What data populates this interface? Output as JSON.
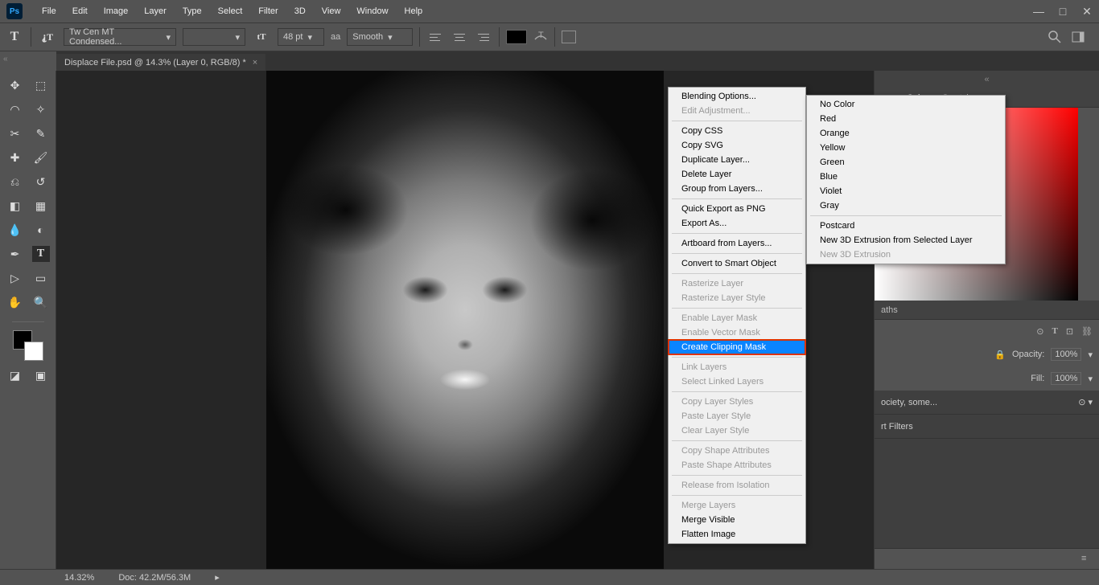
{
  "menubar": {
    "items": [
      "File",
      "Edit",
      "Image",
      "Layer",
      "Type",
      "Select",
      "Filter",
      "3D",
      "View",
      "Window",
      "Help"
    ]
  },
  "options": {
    "font_family": "Tw Cen MT Condensed...",
    "font_size": "48 pt",
    "aa_label": "aa",
    "aa_mode": "Smooth"
  },
  "tab": {
    "title": "Displace File.psd @ 14.3% (Layer 0, RGB/8) *",
    "close": "×"
  },
  "status": {
    "zoom": "14.32%",
    "doc": "Doc: 42.2M/56.3M"
  },
  "color_panel": {
    "tabs": [
      "Color",
      "Swatches"
    ],
    "active": 0
  },
  "paths_tab": "aths",
  "opacity": {
    "label": "Opacity:",
    "value": "100%"
  },
  "fill": {
    "label": "Fill:",
    "value": "100%"
  },
  "layer_text": "ociety, some...",
  "filter_text": "rt Filters",
  "context_menu_main": [
    {
      "t": "Blending Options..."
    },
    {
      "t": "Edit Adjustment...",
      "d": true
    },
    {
      "sep": true
    },
    {
      "t": "Copy CSS"
    },
    {
      "t": "Copy SVG"
    },
    {
      "t": "Duplicate Layer..."
    },
    {
      "t": "Delete Layer"
    },
    {
      "t": "Group from Layers..."
    },
    {
      "sep": true
    },
    {
      "t": "Quick Export as PNG"
    },
    {
      "t": "Export As..."
    },
    {
      "sep": true
    },
    {
      "t": "Artboard from Layers..."
    },
    {
      "sep": true
    },
    {
      "t": "Convert to Smart Object"
    },
    {
      "sep": true
    },
    {
      "t": "Rasterize Layer",
      "d": true
    },
    {
      "t": "Rasterize Layer Style",
      "d": true
    },
    {
      "sep": true
    },
    {
      "t": "Enable Layer Mask",
      "d": true
    },
    {
      "t": "Enable Vector Mask",
      "d": true
    },
    {
      "t": "Create Clipping Mask",
      "hi": true
    },
    {
      "sep": true
    },
    {
      "t": "Link Layers",
      "d": true
    },
    {
      "t": "Select Linked Layers",
      "d": true
    },
    {
      "sep": true
    },
    {
      "t": "Copy Layer Styles",
      "d": true
    },
    {
      "t": "Paste Layer Style",
      "d": true
    },
    {
      "t": "Clear Layer Style",
      "d": true
    },
    {
      "sep": true
    },
    {
      "t": "Copy Shape Attributes",
      "d": true
    },
    {
      "t": "Paste Shape Attributes",
      "d": true
    },
    {
      "sep": true
    },
    {
      "t": "Release from Isolation",
      "d": true
    },
    {
      "sep": true
    },
    {
      "t": "Merge Layers",
      "d": true
    },
    {
      "t": "Merge Visible"
    },
    {
      "t": "Flatten Image"
    }
  ],
  "context_menu_sub": [
    {
      "t": "No Color"
    },
    {
      "t": "Red"
    },
    {
      "t": "Orange"
    },
    {
      "t": "Yellow"
    },
    {
      "t": "Green"
    },
    {
      "t": "Blue"
    },
    {
      "t": "Violet"
    },
    {
      "t": "Gray"
    },
    {
      "sep": true
    },
    {
      "t": "Postcard"
    },
    {
      "t": "New 3D Extrusion from Selected Layer"
    },
    {
      "t": "New 3D Extrusion",
      "d": true
    }
  ]
}
